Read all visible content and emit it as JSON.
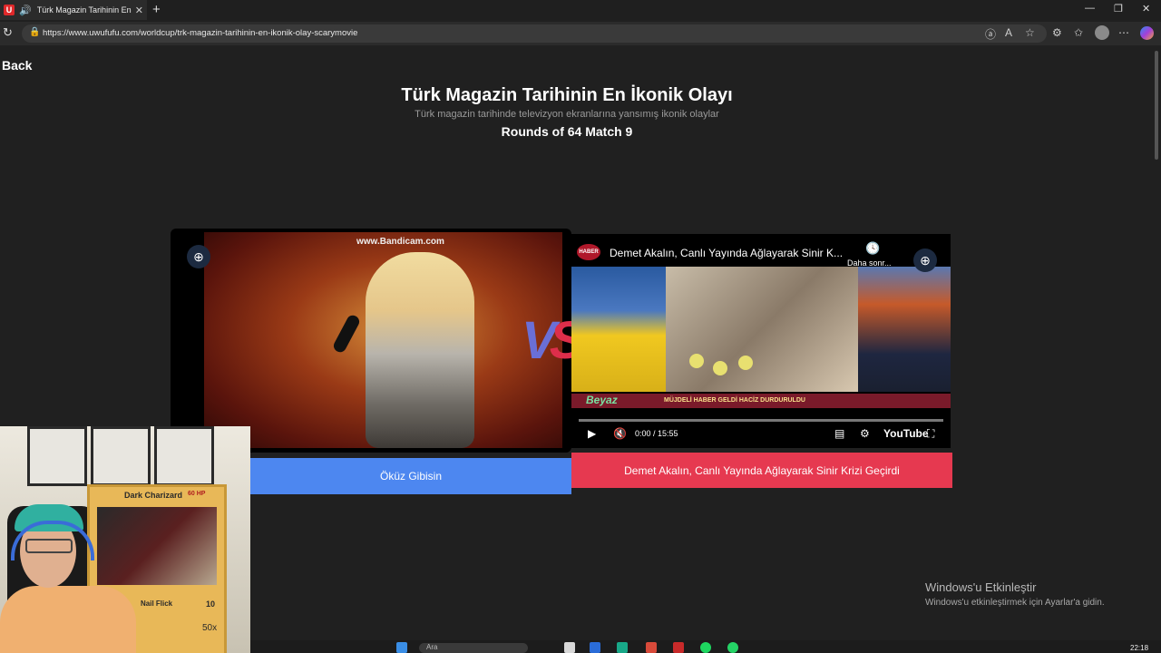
{
  "browser": {
    "tab_title": "Türk Magazin Tarihinin En İkonik Olayı",
    "tab_fav": "U",
    "url": "https://www.uwufufu.com/worldcup/trk-magazin-tarihinin-en-ikonik-olay-scarymovie"
  },
  "page": {
    "back_label": "Back",
    "title": "Türk Magazin Tarihinin En İkonik Olayı",
    "subtitle": "Türk magazin tarihinde televizyon ekranlarına yansımış ikonik olaylar",
    "rounds": "Rounds of 64 Match 9",
    "vs_v": "V",
    "vs_s": "S"
  },
  "left_choice": {
    "watermark": "www.Bandicam.com",
    "label": "Öküz Gibisin"
  },
  "right_choice": {
    "yt_channel": "HABER",
    "video_title": "Demet Akalın, Canlı Yayında Ağlayarak Sinir K...",
    "watch_later": "Daha sonr...",
    "program": "Beyaz",
    "ticker": "MÜJDELİ HABER GELDİ HACİZ DURDURULDU",
    "time": "0:00 / 15:55",
    "yt_brand": "YouTube",
    "label": "Demet Akalın, Canlı Yayında Ağlayarak Sinir Krizi Geçirdi"
  },
  "webcam": {
    "card_name": "Dark Charizard",
    "card_hp": "60 HP",
    "card_attack": "Nail Flick",
    "card_damage": "10",
    "card_multiplier": "50x"
  },
  "windows": {
    "activate_title": "Windows'u Etkinleştir",
    "activate_sub": "Windows'u etkinleştirmek için Ayarlar'a gidin.",
    "search_text": "Ara",
    "clock": "22:18"
  },
  "colors": {
    "left_button": "#4d87f0",
    "right_button": "#e63950",
    "vs_v": "#6a6fd6",
    "vs_s": "#dd2e4a"
  }
}
